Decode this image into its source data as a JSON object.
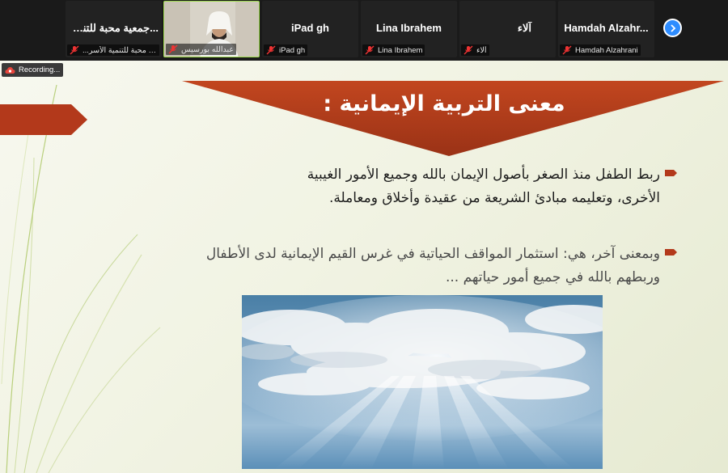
{
  "participants": [
    {
      "tile_name": "Hamdah  Alzahr...",
      "caption": "Hamdah Alzahrani"
    },
    {
      "tile_name": "آلاء",
      "caption": "آلاء"
    },
    {
      "tile_name": "Lina Ibrahem",
      "caption": "Lina Ibrahem"
    },
    {
      "tile_name": "iPad gh",
      "caption": "iPad gh"
    },
    {
      "tile_name": "",
      "caption": "عبدالله بورسيس"
    },
    {
      "tile_name": "...جمعية محبة للتنمية",
      "caption": "...جمعية محبة للتنمية الأسر"
    }
  ],
  "recording": {
    "label": "Recording..."
  },
  "slide": {
    "title": "معنى التربية الإيمانية :",
    "bullets": [
      "ربط الطفل منذ الصغر بأصول الإيمان بالله وجميع الأمور الغيبية الأخرى، وتعليمه مبادئ الشريعة من عقيدة وأخلاق ومعاملة.",
      "وبمعنى آخر، هي: استثمار المواقف الحياتية في غرس القيم الإيمانية لدى الأطفال وربطهم بالله في جميع أمور حياتهم ..."
    ]
  },
  "colors": {
    "banner": "#a53a1c",
    "accent": "#2d8cff",
    "video_border": "#9ad84a"
  },
  "icons": {
    "mic": "muted-mic-icon",
    "next": "chevron-right-icon",
    "recording": "cloud-record-icon"
  }
}
